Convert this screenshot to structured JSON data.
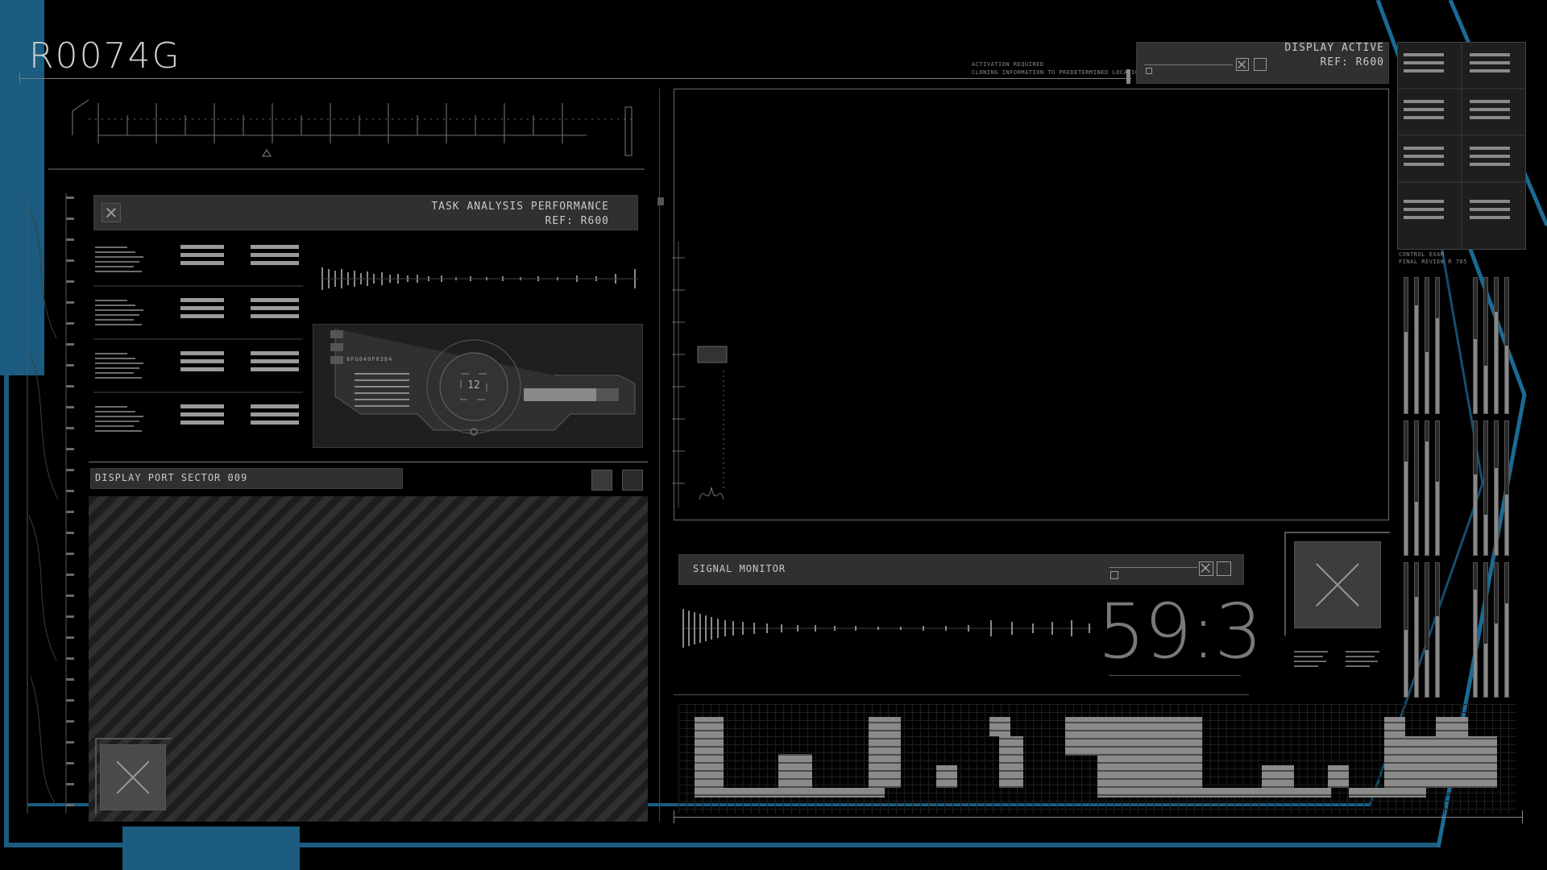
{
  "header": {
    "code": "R0074G"
  },
  "notice": {
    "line1": "ACTIVATION REQUIRED",
    "line2": "CLONING INFORMATION TO PREDETERMINED LOCATION"
  },
  "display_active": {
    "title": "DISPLAY ACTIVE",
    "ref": "REF: R600"
  },
  "task_panel": {
    "title": "TASK ANALYSIS PERFORMANCE",
    "ref": "REF: R600",
    "chip_label": "8FG040F8384",
    "dial_value": "12"
  },
  "display_port": {
    "title": "DISPLAY PORT SECTOR 009"
  },
  "signal_monitor": {
    "title": "SIGNAL MONITOR",
    "readout": "59:3"
  },
  "control_exam": {
    "line1": "CONTROL EXAM",
    "line2": "FINAL REVIEW R 705"
  },
  "colors": {
    "accent": "#1b5c80",
    "panel": "#303030",
    "text": "#c9c9c9"
  },
  "icons": [
    "close-icon",
    "dial-icon",
    "ruler-marker-icon"
  ]
}
